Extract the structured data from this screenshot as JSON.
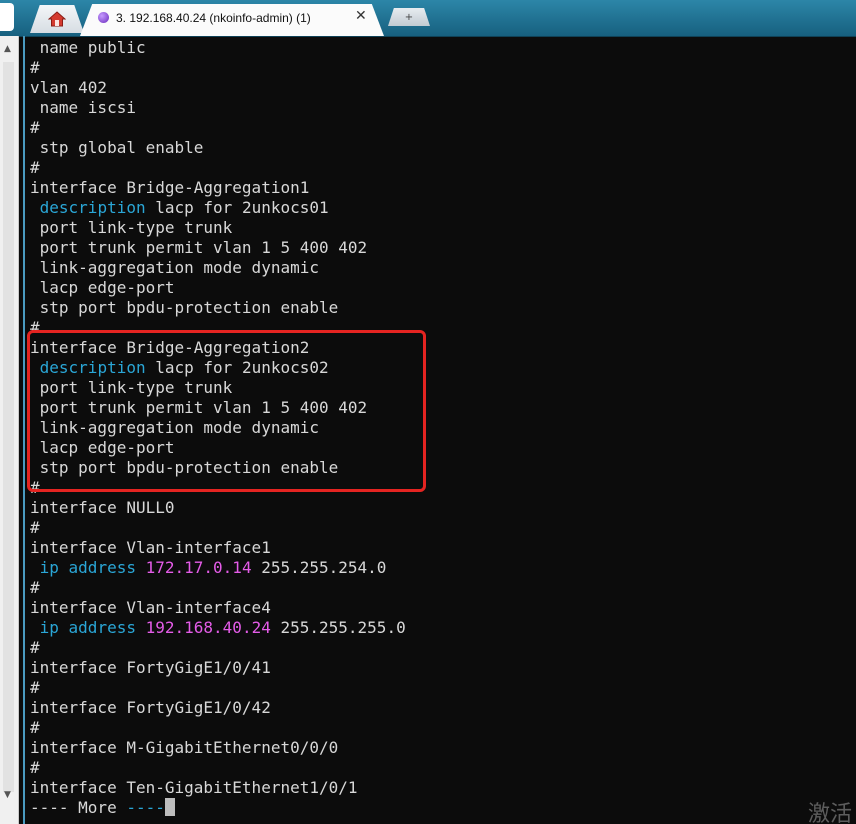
{
  "tabs": {
    "active_title": "3. 192.168.40.24 (nkoinfo-admin) (1)",
    "close_glyph": "✕",
    "new_tab_glyph": "+"
  },
  "terminal": {
    "lines": [
      [
        {
          "t": " name public"
        }
      ],
      [
        {
          "t": "#"
        }
      ],
      [
        {
          "t": "vlan 402"
        }
      ],
      [
        {
          "t": " name iscsi"
        }
      ],
      [
        {
          "t": "#"
        }
      ],
      [
        {
          "t": " stp global enable"
        }
      ],
      [
        {
          "t": "#"
        }
      ],
      [
        {
          "t": "interface Bridge-Aggregation1"
        }
      ],
      [
        {
          "t": " "
        },
        {
          "t": "description",
          "c": "kw"
        },
        {
          "t": " lacp for 2unkocs01"
        }
      ],
      [
        {
          "t": " port link-type trunk"
        }
      ],
      [
        {
          "t": " port trunk permit vlan 1 5 400 402"
        }
      ],
      [
        {
          "t": " link-aggregation mode dynamic"
        }
      ],
      [
        {
          "t": " lacp edge-port"
        }
      ],
      [
        {
          "t": " stp port bpdu-protection enable"
        }
      ],
      [
        {
          "t": "#"
        }
      ],
      [
        {
          "t": "interface Bridge-Aggregation2"
        }
      ],
      [
        {
          "t": " "
        },
        {
          "t": "description",
          "c": "kw"
        },
        {
          "t": " lacp for 2unkocs02"
        }
      ],
      [
        {
          "t": " port link-type trunk"
        }
      ],
      [
        {
          "t": " port trunk permit vlan 1 5 400 402"
        }
      ],
      [
        {
          "t": " link-aggregation mode dynamic"
        }
      ],
      [
        {
          "t": " lacp edge-port"
        }
      ],
      [
        {
          "t": " stp port bpdu-protection enable"
        }
      ],
      [
        {
          "t": "#"
        }
      ],
      [
        {
          "t": "interface NULL0"
        }
      ],
      [
        {
          "t": "#"
        }
      ],
      [
        {
          "t": "interface Vlan-interface1"
        }
      ],
      [
        {
          "t": " "
        },
        {
          "t": "ip address",
          "c": "kw"
        },
        {
          "t": " "
        },
        {
          "t": "172.17.0.14",
          "c": "ip"
        },
        {
          "t": " 255.255.254.0"
        }
      ],
      [
        {
          "t": "#"
        }
      ],
      [
        {
          "t": "interface Vlan-interface4"
        }
      ],
      [
        {
          "t": " "
        },
        {
          "t": "ip address",
          "c": "kw"
        },
        {
          "t": " "
        },
        {
          "t": "192.168.40.24",
          "c": "ip"
        },
        {
          "t": " 255.255.255.0"
        }
      ],
      [
        {
          "t": "#"
        }
      ],
      [
        {
          "t": "interface FortyGigE1/0/41"
        }
      ],
      [
        {
          "t": "#"
        }
      ],
      [
        {
          "t": "interface FortyGigE1/0/42"
        }
      ],
      [
        {
          "t": "#"
        }
      ],
      [
        {
          "t": "interface M-GigabitEthernet0/0/0"
        }
      ],
      [
        {
          "t": "#"
        }
      ],
      [
        {
          "t": "interface Ten-GigabitEthernet1/0/1"
        }
      ],
      [
        {
          "t": "---- More "
        },
        {
          "t": "----",
          "c": "kw"
        },
        {
          "cursor": true
        }
      ]
    ]
  },
  "watermark": "激活",
  "colors": {
    "background": "#0c0c0c",
    "text": "#d8d8d8",
    "keyword": "#2aa6d6",
    "ip_value": "#e45ce8",
    "highlight_border": "#e52421",
    "tabbar": "#1e6e8e"
  },
  "icons": {
    "home": "home-icon",
    "session": "session-status-icon"
  }
}
